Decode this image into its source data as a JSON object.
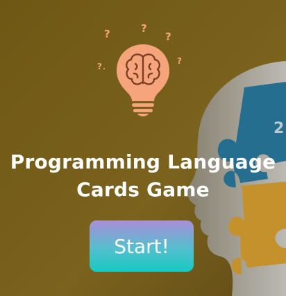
{
  "title": {
    "line1": "Programming Language",
    "line2": "Cards Game"
  },
  "start_button": {
    "label": "Start!"
  },
  "logo": {
    "icon": "lightbulb-brain-icon",
    "color": "#f4a57d"
  },
  "colors": {
    "background": "#8a6e20",
    "text": "#ffffff",
    "button_gradient_top": "#a98ed8",
    "button_gradient_bottom": "#16c9c2",
    "puzzle_blue": "#2a7fa6",
    "puzzle_orange": "#e0a632"
  }
}
